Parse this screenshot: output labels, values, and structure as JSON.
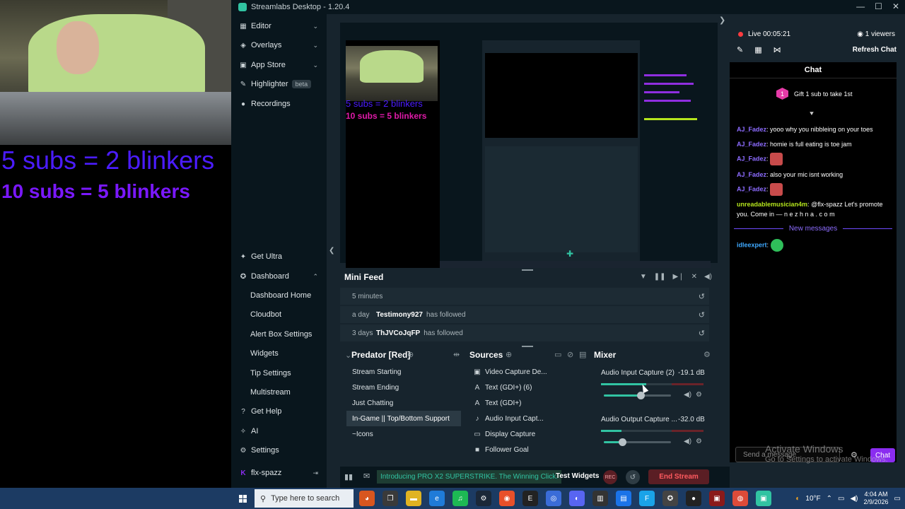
{
  "overlay": {
    "line1": "5 subs = 2 blinkers",
    "line2": "10 subs = 5 blinkers"
  },
  "window": {
    "title": "Streamlabs Desktop - 1.20.4",
    "controls": [
      "—",
      "☐",
      "✕"
    ]
  },
  "sidebar": {
    "top_items": [
      {
        "label": "Editor",
        "icon": "editor-icon",
        "chevron": "⌄"
      },
      {
        "label": "Overlays",
        "icon": "overlays-icon",
        "chevron": "⌄"
      },
      {
        "label": "App Store",
        "icon": "app-store-icon",
        "chevron": "⌄"
      },
      {
        "label": "Highlighter",
        "icon": "highlighter-icon",
        "badge": "beta"
      },
      {
        "label": "Recordings",
        "icon": "recordings-icon"
      }
    ],
    "get_ultra": "Get Ultra",
    "dashboard": "Dashboard",
    "dashboard_items": [
      "Dashboard Home",
      "Cloudbot",
      "Alert Box Settings",
      "Widgets",
      "Tip Settings",
      "Multistream"
    ],
    "bottom_items": [
      "Get Help",
      "AI",
      "Settings"
    ],
    "user": "flx-spazz"
  },
  "preview": {
    "t1": "5 subs = 2 blinkers",
    "t2": "10 subs = 5 blinkers"
  },
  "minifeed": {
    "title": "Mini Feed",
    "rows": [
      {
        "time": "5 minutes",
        "name": "",
        "action": ""
      },
      {
        "time": "a day",
        "name": "Testimony927",
        "action": "has followed"
      },
      {
        "time": "3 days",
        "name": "ThJVCoJqFP",
        "action": "has followed"
      }
    ]
  },
  "scenes": {
    "title": "Predator [Red]",
    "items": [
      "Stream Starting",
      "Stream Ending",
      "Just Chatting",
      "In-Game || Top/Bottom Support",
      "~Icons"
    ],
    "active_index": 3
  },
  "sources": {
    "title": "Sources",
    "items": [
      {
        "icon": "video-capture-icon",
        "label": "Video Capture De..."
      },
      {
        "icon": "text-icon",
        "label": "Text (GDI+) (6)"
      },
      {
        "icon": "text-icon",
        "label": "Text (GDI+)"
      },
      {
        "icon": "audio-input-icon",
        "label": "Audio Input Capt..."
      },
      {
        "icon": "display-capture-icon",
        "label": "Display Capture"
      },
      {
        "icon": "follower-goal-icon",
        "label": "Follower Goal"
      }
    ]
  },
  "mixer": {
    "title": "Mixer",
    "channels": [
      {
        "name": "Audio Input Capture (2)",
        "db": "-19.1 dB",
        "level": 0.44,
        "volume": 0.55
      },
      {
        "name": "Audio Output Capture ...",
        "db": "-32.0 dB",
        "level": 0.2,
        "volume": 0.27
      }
    ]
  },
  "footer": {
    "promo": "Introducing PRO X2 SUPERSTRIKE. The Winning Click.",
    "test_widgets": "Test Widgets",
    "rec": "REC",
    "end_stream": "End Stream"
  },
  "chat": {
    "live": "Live 00:05:21",
    "viewers": "1 viewers",
    "refresh": "Refresh Chat",
    "title": "Chat",
    "gift": "Gift 1 sub to take 1st",
    "gift_count": "1",
    "messages": [
      {
        "user": "AJ_Fadez",
        "text": "yooo why you nibbleing on your toes",
        "color": "#8d6cff"
      },
      {
        "user": "AJ_Fadez",
        "text": "homie is full eating is toe jam",
        "color": "#8d6cff"
      },
      {
        "user": "AJ_Fadez",
        "text": "",
        "color": "#8d6cff",
        "emote": true
      },
      {
        "user": "AJ_Fadez",
        "text": "also your mic isnt working",
        "color": "#8d6cff"
      },
      {
        "user": "AJ_Fadez",
        "text": "",
        "color": "#8d6cff",
        "emote": true
      },
      {
        "user": "unreadablemusician4m",
        "text": "@flx-spazz Let's promote you. Come in — n e z h n a . c o m",
        "color": "#b5e61d"
      }
    ],
    "new_messages": "New messages",
    "after_user": "idleexpert",
    "after_color": "#3fa9ff",
    "placeholder": "Send a message",
    "send": "Chat"
  },
  "activate": {
    "title": "Activate Windows",
    "sub": "Go to Settings to activate Windows."
  },
  "taskbar": {
    "search_placeholder": "Type here to search",
    "weather": "10°F",
    "time": "4:04 AM",
    "date": "2/9/2026"
  }
}
